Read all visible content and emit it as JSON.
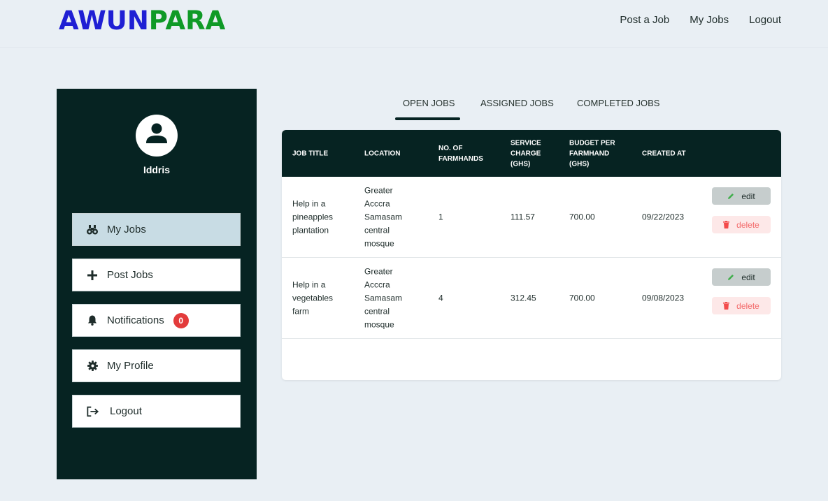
{
  "brand": {
    "part1": "AWUN",
    "part2": "PARA"
  },
  "topnav": [
    {
      "label": "Post a Job"
    },
    {
      "label": "My Jobs"
    },
    {
      "label": "Logout"
    }
  ],
  "sidebar": {
    "username": "Iddris",
    "items": [
      {
        "label": "My Jobs",
        "icon": "binoculars-icon",
        "active": true
      },
      {
        "label": "Post Jobs",
        "icon": "plus-icon"
      },
      {
        "label": "Notifications",
        "icon": "bell-icon",
        "badge": "0"
      },
      {
        "label": "My Profile",
        "icon": "gear-icon"
      },
      {
        "label": "Logout",
        "icon": "logout-icon"
      }
    ]
  },
  "tabs": [
    {
      "label": "OPEN JOBS",
      "active": true
    },
    {
      "label": "ASSIGNED JOBS"
    },
    {
      "label": "COMPLETED JOBS"
    }
  ],
  "table": {
    "headers": {
      "job_title": "JOB TITLE",
      "location": "LOCATION",
      "farmhands": "NO. OF FARMHANDS",
      "service_charge": "SERVICE CHARGE (GHS)",
      "budget": "BUDGET PER FARMHAND (GHS)",
      "created_at": "CREATED AT"
    },
    "rows": [
      {
        "job_title": "Help in a pineapples plantation",
        "location": "Greater Acccra Samasam central mosque",
        "farmhands": "1",
        "service_charge": "111.57",
        "budget": "700.00",
        "created_at": "09/22/2023",
        "edit_label": "edit",
        "delete_label": "delete"
      },
      {
        "job_title": "Help in a vegetables farm",
        "location": "Greater Acccra Samasam central mosque",
        "farmhands": "4",
        "service_charge": "312.45",
        "budget": "700.00",
        "created_at": "09/08/2023",
        "edit_label": "edit",
        "delete_label": "delete"
      }
    ]
  },
  "colors": {
    "brand_blue": "#1f1fd4",
    "brand_green": "#0f9a26",
    "sidebar_bg": "#062322",
    "active_item_bg": "#c8dce4",
    "badge_red": "#e33b3b",
    "delete_text": "#f36b6b"
  }
}
